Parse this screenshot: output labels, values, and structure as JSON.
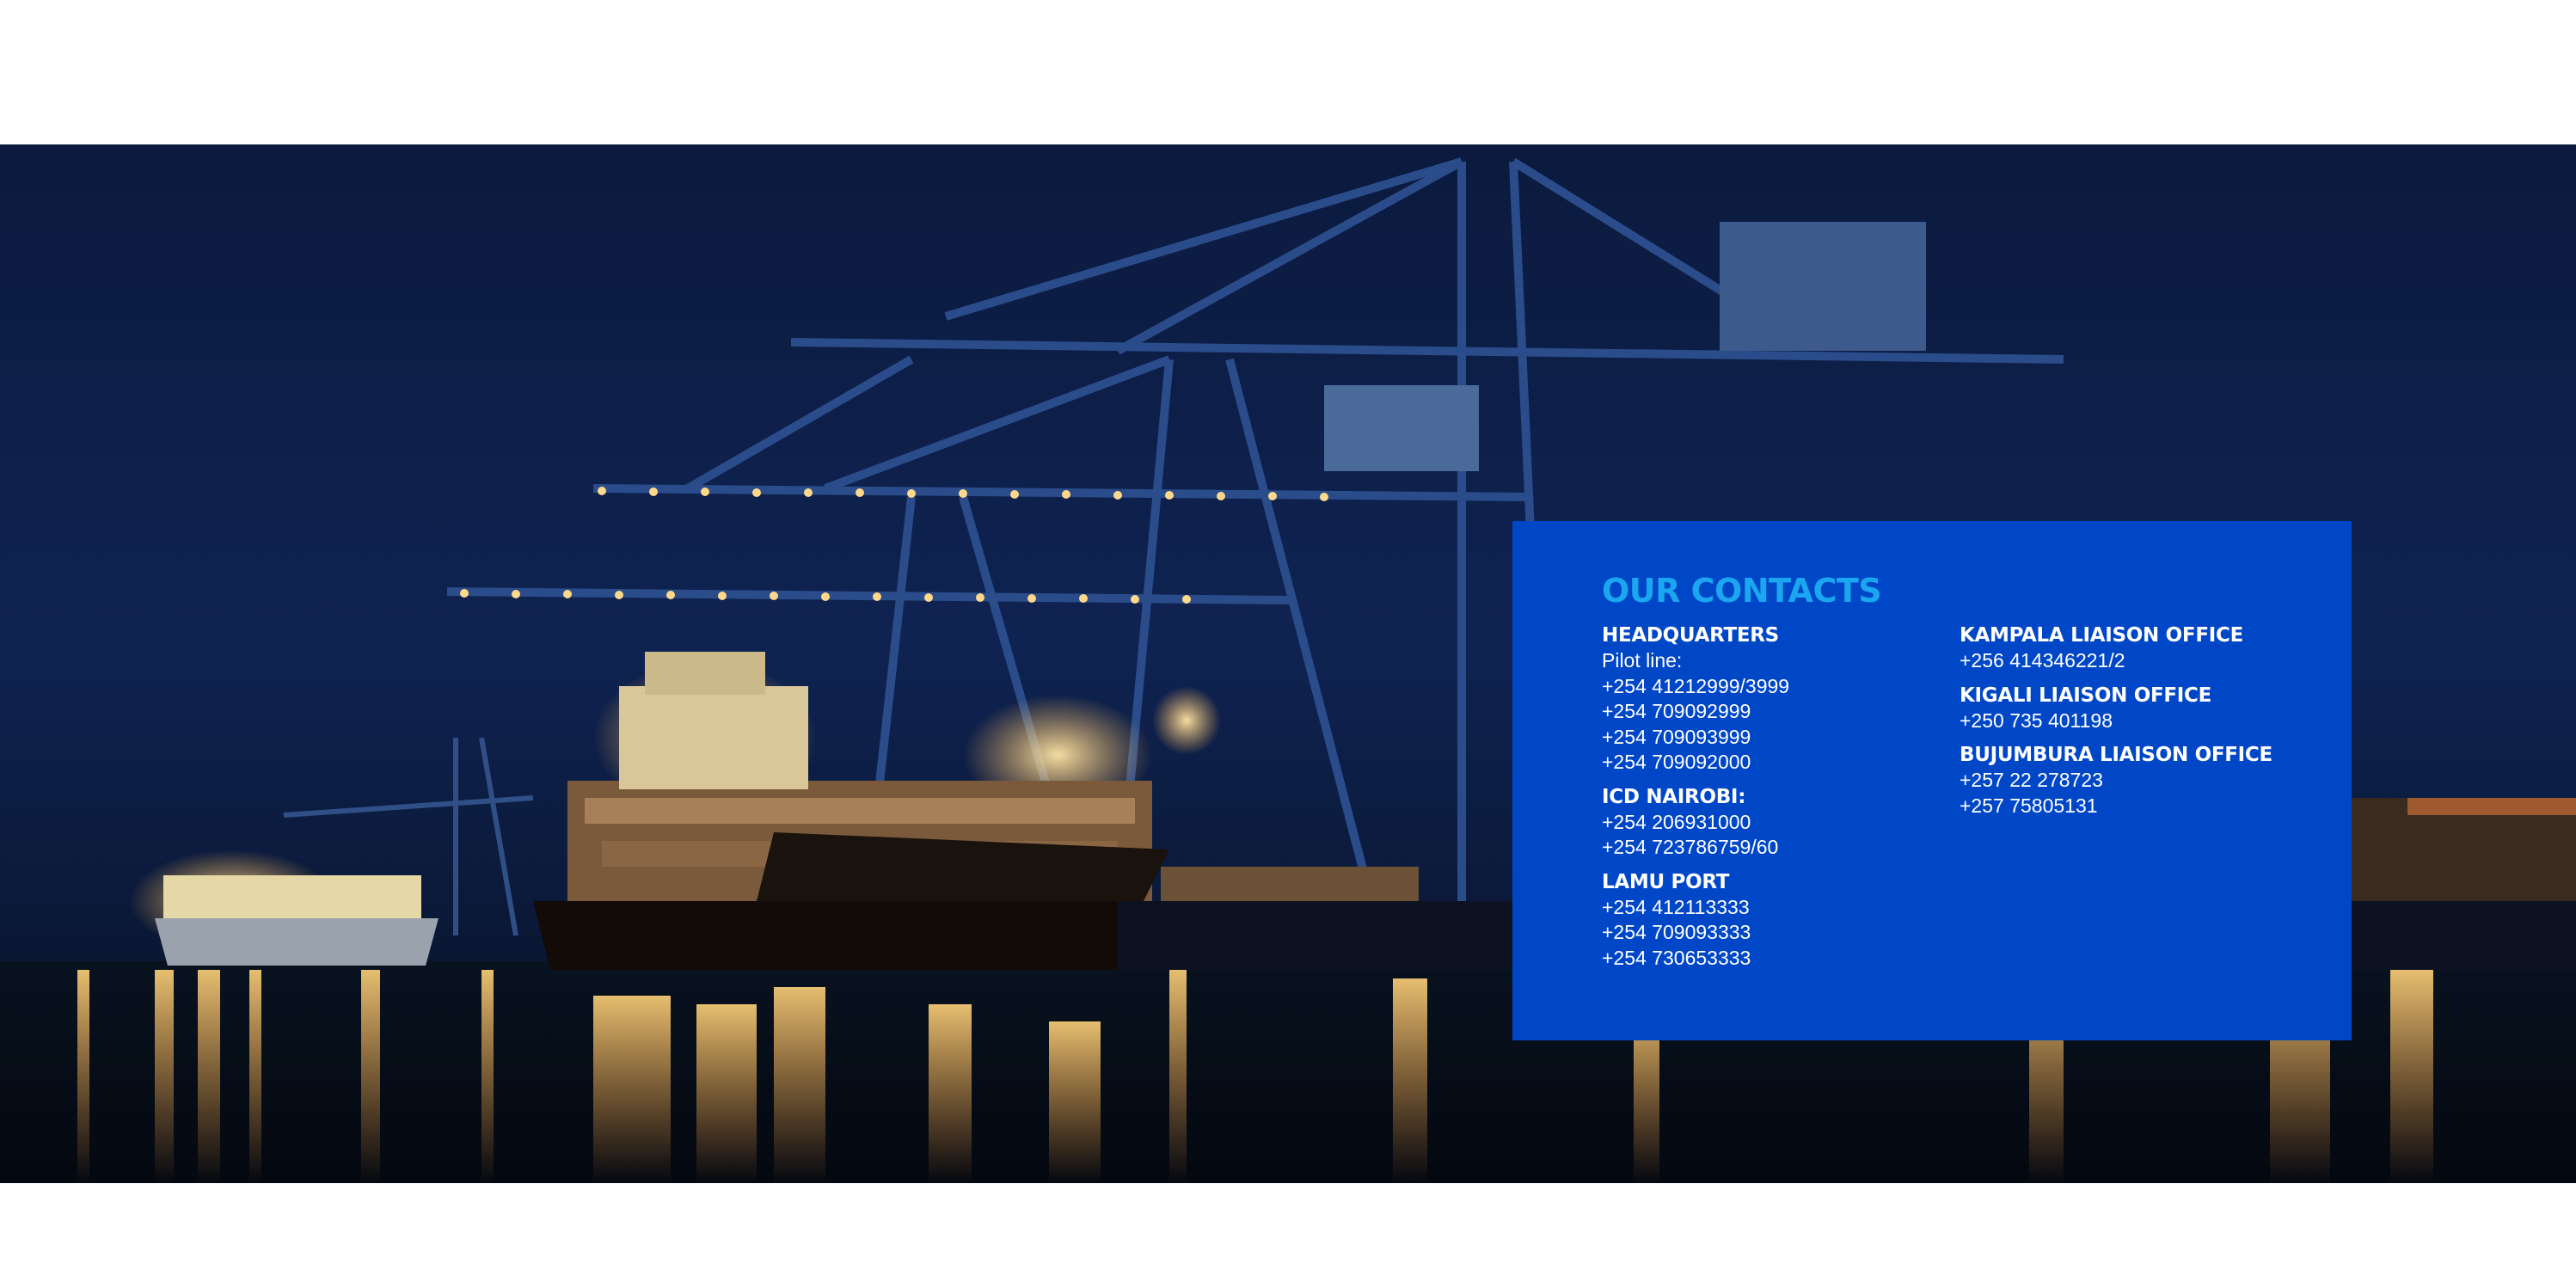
{
  "hero": {
    "image": "night-port-container-ship-cranes"
  },
  "colors": {
    "panel_bg": "#0047c8",
    "title": "#1ba6f0",
    "text": "#ffffff"
  },
  "contacts": {
    "title": "OUR CONTACTS",
    "left": [
      {
        "name": "HEADQUARTERS",
        "lines": [
          "Pilot line:",
          "+254 41212999/3999",
          "+254 709092999",
          "+254 709093999",
          "+254 709092000"
        ]
      },
      {
        "name": "ICD NAIROBI:",
        "lines": [
          "+254 206931000",
          "+254 723786759/60"
        ]
      },
      {
        "name": "LAMU PORT",
        "lines": [
          "+254 412113333",
          "+254 709093333",
          "+254 730653333"
        ]
      }
    ],
    "right": [
      {
        "name": "KAMPALA LIAISON OFFICE",
        "lines": [
          "+256 414346221/2"
        ]
      },
      {
        "name": "KIGALI LIAISON OFFICE",
        "lines": [
          "+250 735 401198"
        ]
      },
      {
        "name": "BUJUMBURA LIAISON OFFICE",
        "lines": [
          "+257 22 278723",
          "+257 75805131"
        ]
      }
    ]
  }
}
